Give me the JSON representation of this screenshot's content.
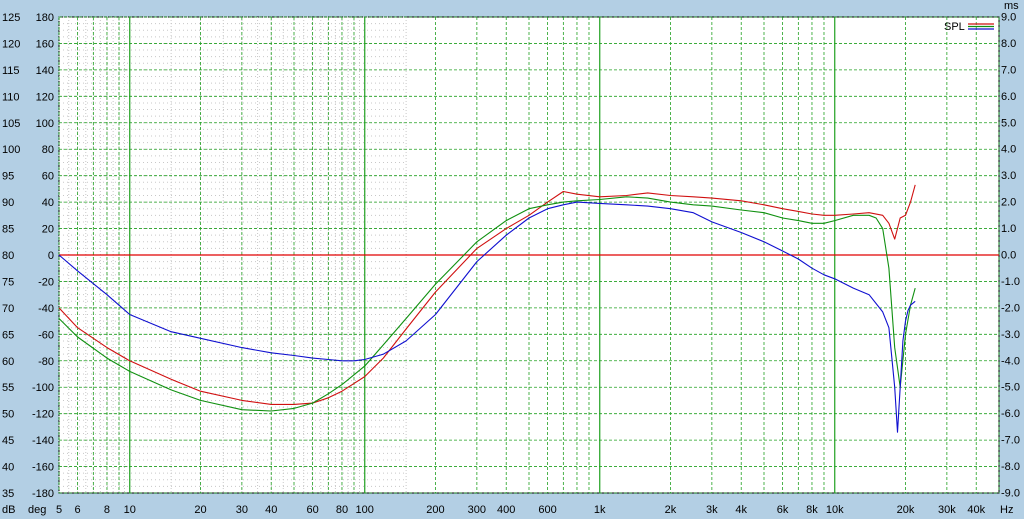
{
  "chart_data": {
    "type": "line",
    "title": "",
    "x_scale": "log",
    "xlim": [
      5,
      50000
    ],
    "x_unit": "Hz",
    "x_ticks": [
      {
        "v": 5,
        "label": "5"
      },
      {
        "v": 6,
        "label": "6"
      },
      {
        "v": 8,
        "label": "8"
      },
      {
        "v": 10,
        "label": "10"
      },
      {
        "v": 20,
        "label": "20"
      },
      {
        "v": 30,
        "label": "30"
      },
      {
        "v": 40,
        "label": "40"
      },
      {
        "v": 60,
        "label": "60"
      },
      {
        "v": 80,
        "label": "80"
      },
      {
        "v": 100,
        "label": "100"
      },
      {
        "v": 200,
        "label": "200"
      },
      {
        "v": 300,
        "label": "300"
      },
      {
        "v": 400,
        "label": "400"
      },
      {
        "v": 600,
        "label": "600"
      },
      {
        "v": 1000,
        "label": "1k"
      },
      {
        "v": 2000,
        "label": "2k"
      },
      {
        "v": 3000,
        "label": "3k"
      },
      {
        "v": 4000,
        "label": "4k"
      },
      {
        "v": 6000,
        "label": "6k"
      },
      {
        "v": 8000,
        "label": "8k"
      },
      {
        "v": 10000,
        "label": "10k"
      },
      {
        "v": 20000,
        "label": "20k"
      },
      {
        "v": 30000,
        "label": "30k"
      },
      {
        "v": 40000,
        "label": "40k"
      }
    ],
    "y_db": {
      "unit": "dB",
      "ylim": [
        35,
        125
      ],
      "ticks": [
        125,
        120,
        115,
        110,
        105,
        100,
        95,
        90,
        85,
        80,
        75,
        70,
        65,
        60,
        55,
        50,
        45,
        40,
        35
      ]
    },
    "y_deg": {
      "unit": "deg",
      "ylim": [
        -180,
        180
      ],
      "ticks": [
        180,
        160,
        140,
        120,
        100,
        80,
        60,
        40,
        20,
        0,
        -20,
        -40,
        -60,
        -80,
        -100,
        -120,
        -140,
        -160,
        -180
      ]
    },
    "y_ms": {
      "unit": "ms",
      "ylim": [
        -9,
        9
      ],
      "ticks": [
        "9.0",
        "8.0",
        "7.0",
        "6.0",
        "5.0",
        "4.0",
        "3.0",
        "2.0",
        "1.0",
        "0.0",
        "-1.0",
        "-2.0",
        "-3.0",
        "-4.0",
        "-5.0",
        "-6.0",
        "-7.0",
        "-8.0",
        "-9.0"
      ]
    },
    "legend": {
      "label": "SPL",
      "position": "top-right"
    },
    "colors": {
      "background": "#b3cfe4",
      "plot": "#ffffff",
      "grid": "#20a020",
      "minor_grid": "#c8c8c8",
      "zero_line": "#e00000",
      "red": "#d01010",
      "green": "#109010",
      "blue": "#1010d0"
    },
    "series": [
      {
        "color": "red",
        "x": [
          5,
          6,
          8,
          10,
          15,
          20,
          30,
          40,
          50,
          60,
          70,
          80,
          100,
          120,
          150,
          200,
          300,
          400,
          500,
          600,
          700,
          800,
          1000,
          1300,
          1600,
          2000,
          2500,
          3000,
          4000,
          5000,
          6000,
          7000,
          8000,
          9000,
          10000,
          12000,
          14000,
          16000,
          17000,
          18000,
          19000,
          20000,
          21000,
          22000
        ],
        "y": [
          -40,
          -55,
          -70,
          -80,
          -94,
          -103,
          -110,
          -113,
          -113,
          -112,
          -108,
          -103,
          -92,
          -78,
          -56,
          -28,
          5,
          20,
          30,
          40,
          48,
          46,
          44,
          45,
          47,
          45,
          44,
          43,
          41,
          38,
          35,
          33,
          31,
          30,
          30,
          31,
          32,
          30,
          24,
          12,
          28,
          30,
          40,
          53
        ]
      },
      {
        "color": "green",
        "x": [
          5,
          6,
          8,
          10,
          15,
          20,
          30,
          40,
          50,
          60,
          70,
          80,
          100,
          120,
          150,
          200,
          300,
          400,
          500,
          600,
          700,
          800,
          1000,
          1300,
          1600,
          2000,
          2500,
          3000,
          4000,
          5000,
          6000,
          7000,
          8000,
          9000,
          10000,
          12000,
          14000,
          15000,
          16000,
          17000,
          18000,
          19000,
          20000,
          21000,
          22000
        ],
        "y": [
          -48,
          -62,
          -78,
          -88,
          -102,
          -110,
          -117,
          -118,
          -116,
          -112,
          -105,
          -98,
          -84,
          -68,
          -48,
          -22,
          10,
          26,
          35,
          38,
          40,
          41,
          42,
          44,
          43,
          40,
          38,
          37,
          34,
          32,
          28,
          26,
          24,
          24,
          26,
          30,
          30,
          28,
          20,
          -10,
          -70,
          -100,
          -60,
          -38,
          -25
        ]
      },
      {
        "color": "blue",
        "x": [
          5,
          6,
          8,
          10,
          15,
          20,
          30,
          40,
          50,
          60,
          70,
          80,
          90,
          100,
          120,
          150,
          200,
          300,
          400,
          500,
          600,
          700,
          800,
          1000,
          1300,
          1600,
          2000,
          2500,
          3000,
          4000,
          5000,
          6000,
          7000,
          8000,
          9000,
          10000,
          12000,
          14000,
          16000,
          17000,
          18000,
          18500,
          19000,
          19500,
          20000,
          20500,
          21000,
          22000
        ],
        "y": [
          0,
          -12,
          -30,
          -45,
          -58,
          -63,
          -70,
          -74,
          -76,
          -78,
          -79,
          -80,
          -80,
          -79,
          -75,
          -65,
          -45,
          -5,
          15,
          28,
          35,
          38,
          40,
          39,
          38,
          37,
          35,
          32,
          25,
          17,
          10,
          3,
          -3,
          -10,
          -15,
          -18,
          -25,
          -30,
          -43,
          -55,
          -100,
          -134,
          -100,
          -65,
          -50,
          -42,
          -38,
          -35
        ]
      }
    ]
  }
}
